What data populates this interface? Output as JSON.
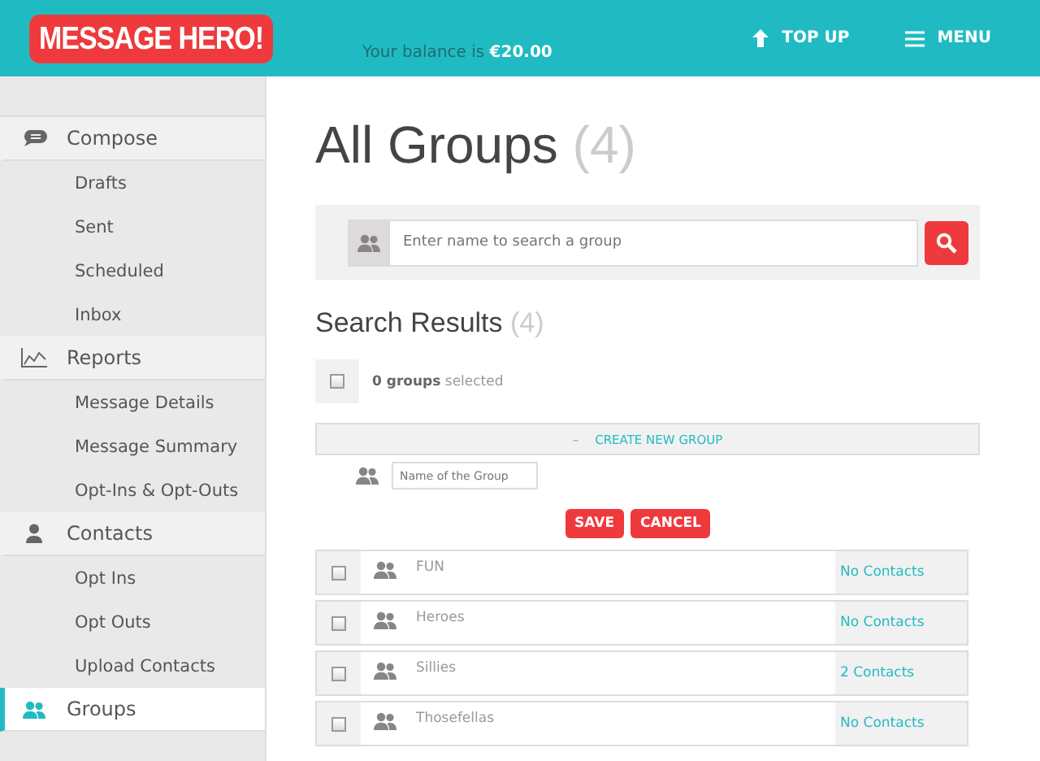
{
  "header": {
    "logo": "MESSAGE HERO!",
    "balance_label": "Your balance is",
    "balance": "€20.00",
    "actions": [
      {
        "kind": "topup",
        "label": "TOP UP"
      },
      {
        "kind": "menu",
        "label": "MENU"
      }
    ]
  },
  "sidebar": {
    "sections": [
      {
        "label": "Compose",
        "kind": "chat",
        "selected": false,
        "children": [
          {
            "label": "Drafts"
          },
          {
            "label": "Sent"
          },
          {
            "label": "Scheduled"
          },
          {
            "label": "Inbox"
          }
        ]
      },
      {
        "label": "Reports",
        "kind": "chart",
        "selected": false,
        "children": [
          {
            "label": "Message Details"
          },
          {
            "label": "Message Summary"
          },
          {
            "label": "Opt-Ins & Opt-Outs"
          }
        ]
      },
      {
        "label": "Contacts",
        "kind": "person",
        "selected": false,
        "children": [
          {
            "label": "Opt Ins"
          },
          {
            "label": "Opt Outs"
          },
          {
            "label": "Upload Contacts"
          }
        ]
      },
      {
        "label": "Groups",
        "kind": "group",
        "selected": true
      }
    ]
  },
  "page": {
    "title": "All Groups",
    "count": "(4)",
    "search": {
      "placeholder": "Enter name to search a group"
    },
    "results_title": "Search Results",
    "results_count": "(4)",
    "selection": {
      "text": "**0 groups** selected",
      "checked": false
    },
    "create": {
      "symbol": "–",
      "label": "CREATE NEW GROUP",
      "name_placeholder": "Name of the Group",
      "buttons": [
        "SAVE",
        "CANCEL"
      ]
    },
    "groups": [
      {
        "name": "FUN",
        "contacts": "No Contacts",
        "checked": false
      },
      {
        "name": "Heroes",
        "contacts": "No Contacts",
        "checked": false
      },
      {
        "name": "Sillies",
        "contacts": "2 Contacts",
        "checked": false
      },
      {
        "name": "Thosefellas",
        "contacts": "No Contacts",
        "checked": false
      }
    ]
  }
}
